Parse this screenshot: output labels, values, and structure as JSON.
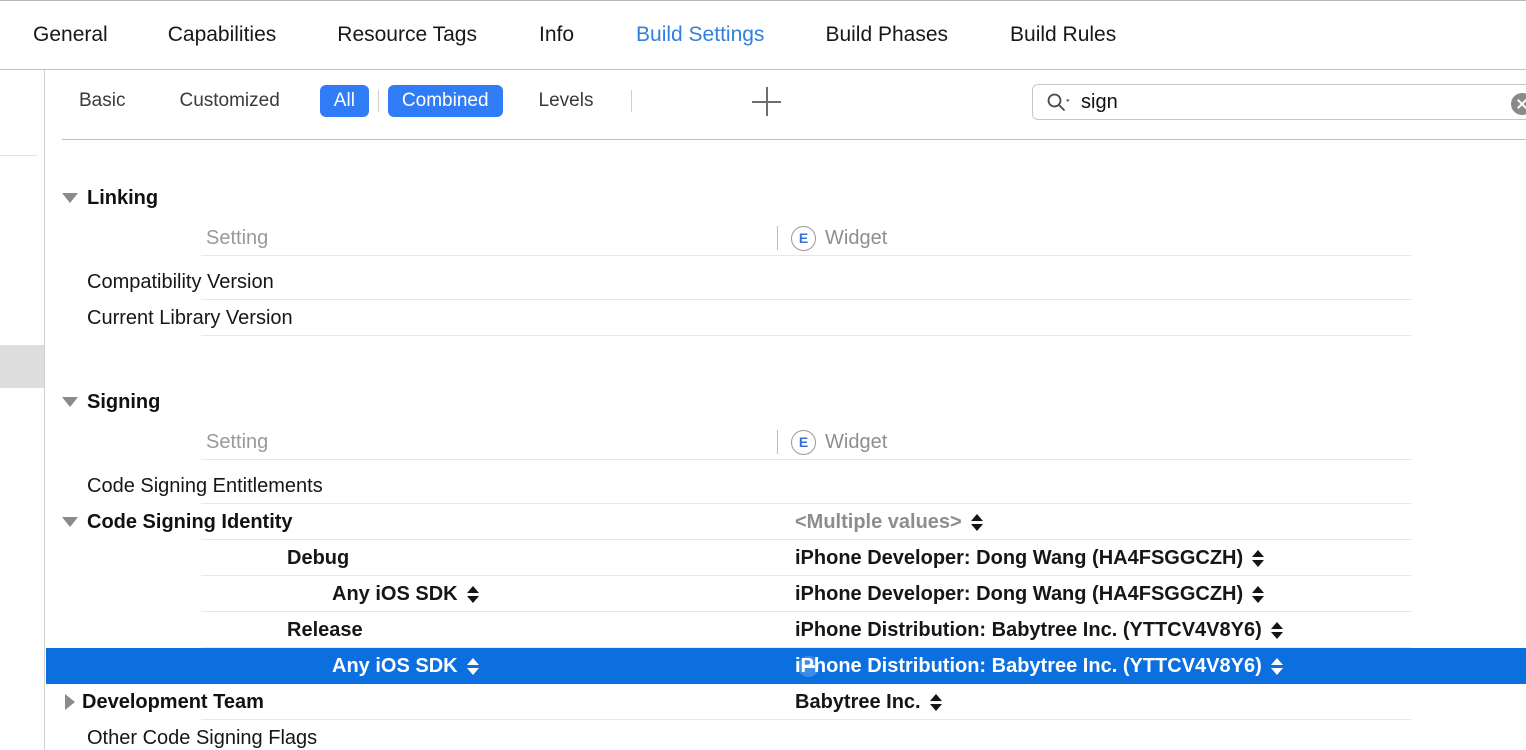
{
  "tabs": [
    {
      "label": "General",
      "active": false
    },
    {
      "label": "Capabilities",
      "active": false
    },
    {
      "label": "Resource Tags",
      "active": false
    },
    {
      "label": "Info",
      "active": false
    },
    {
      "label": "Build Settings",
      "active": true
    },
    {
      "label": "Build Phases",
      "active": false
    },
    {
      "label": "Build Rules",
      "active": false
    }
  ],
  "filterbar": {
    "segments": [
      {
        "label": "Basic",
        "selected": false
      },
      {
        "label": "Customized",
        "selected": false
      },
      {
        "label": "All",
        "selected": true
      },
      {
        "label": "Combined",
        "selected": true
      },
      {
        "label": "Levels",
        "selected": false
      }
    ],
    "add_button": "+",
    "search": {
      "value": "sign",
      "placeholder": "",
      "icon": "search-icon",
      "clear_icon": "clear-icon"
    }
  },
  "columns": {
    "setting_header": "Setting",
    "target_header": "Widget",
    "target_badge": "E"
  },
  "sections": [
    {
      "title": "Linking",
      "expanded": true,
      "rows": [
        {
          "type": "column-header"
        },
        {
          "type": "setting",
          "name": "Compatibility Version",
          "value": ""
        },
        {
          "type": "setting",
          "name": "Current Library Version",
          "value": ""
        }
      ]
    },
    {
      "title": "Signing",
      "expanded": true,
      "rows": [
        {
          "type": "column-header"
        },
        {
          "type": "setting",
          "name": "Code Signing Entitlements",
          "value": ""
        },
        {
          "type": "group",
          "name": "Code Signing Identity",
          "expanded": true,
          "value": "<Multiple values>",
          "value_muted": true,
          "has_stepper": true
        },
        {
          "type": "config",
          "name": "Debug",
          "value": "iPhone Developer: Dong Wang (HA4FSGGCZH)",
          "has_stepper": true
        },
        {
          "type": "sdk",
          "name": "Any iOS SDK",
          "name_stepper": true,
          "value": "iPhone Developer: Dong Wang (HA4FSGGCZH)",
          "has_stepper": true
        },
        {
          "type": "config",
          "name": "Release",
          "value": "iPhone Distribution: Babytree Inc. (YTTCV4V8Y6)",
          "has_stepper": true
        },
        {
          "type": "sdk",
          "name": "Any iOS SDK",
          "name_stepper": true,
          "value": "iPhone Distribution: Babytree Inc. (YTTCV4V8Y6)",
          "has_stepper": true,
          "selected": true,
          "remove_button": true
        },
        {
          "type": "group",
          "name": "Development Team",
          "expanded": false,
          "value": "Babytree Inc.",
          "has_stepper": true
        },
        {
          "type": "setting",
          "name": "Other Code Signing Flags",
          "value": ""
        }
      ]
    }
  ],
  "colors": {
    "accent_blue": "#2f7cf6",
    "selection_blue": "#0b6fe0",
    "active_tab_blue": "#2f81dd",
    "badge_blue": "#3a6fd8",
    "muted_text": "#8d8d8d"
  }
}
